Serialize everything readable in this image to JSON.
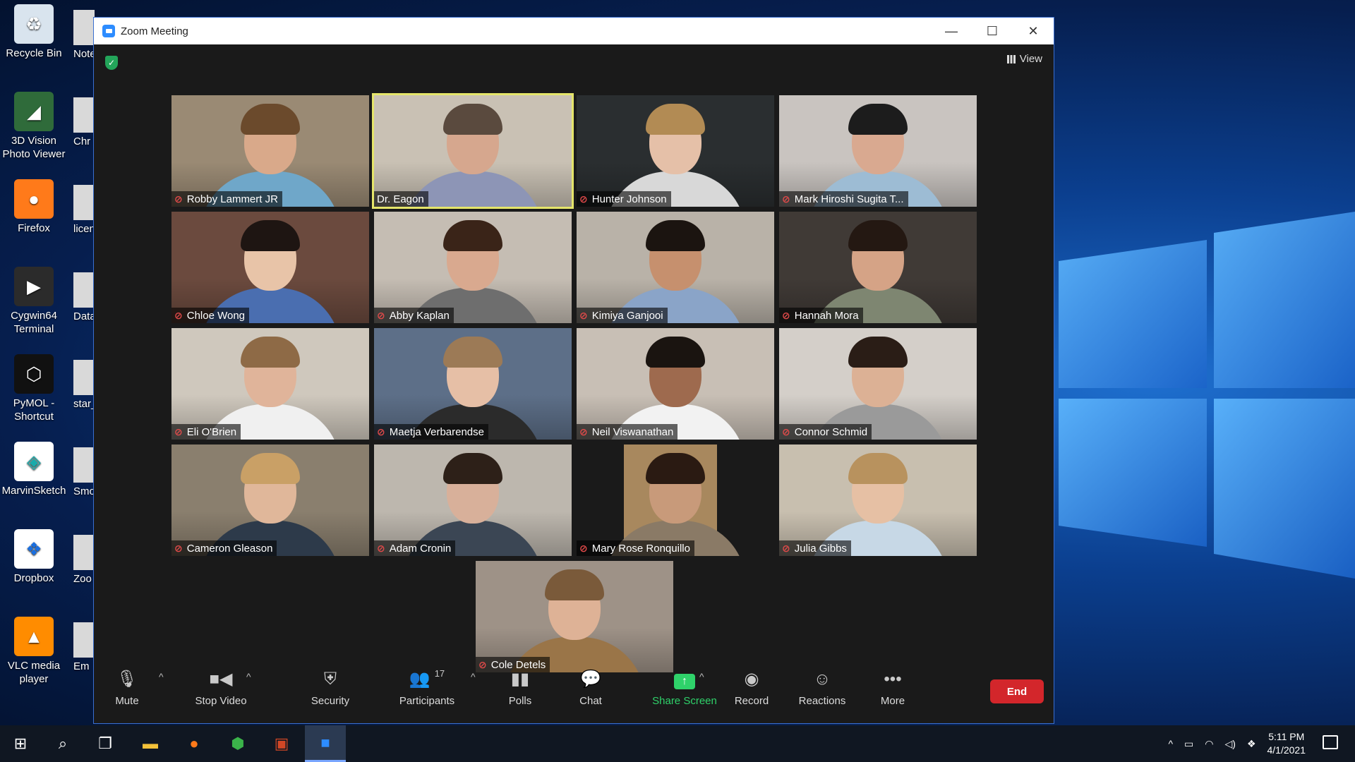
{
  "desktop": {
    "icons": [
      {
        "label_line1": "Recycle Bin",
        "label_line2": "",
        "icon": "recycle-bin-icon"
      },
      {
        "label_line1": "3D Vision",
        "label_line2": "Photo Viewer",
        "icon": "3d-vision-icon"
      },
      {
        "label_line1": "Firefox",
        "label_line2": "",
        "icon": "firefox-icon"
      },
      {
        "label_line1": "Cygwin64",
        "label_line2": "Terminal",
        "icon": "cygwin-icon"
      },
      {
        "label_line1": "PyMOL -",
        "label_line2": "Shortcut",
        "icon": "pymol-icon"
      },
      {
        "label_line1": "MarvinSketch",
        "label_line2": "",
        "icon": "marvinsketch-icon"
      },
      {
        "label_line1": "Dropbox",
        "label_line2": "",
        "icon": "dropbox-icon"
      },
      {
        "label_line1": "VLC media",
        "label_line2": "player",
        "icon": "vlc-icon"
      }
    ],
    "col2_labels": [
      "Note",
      "Chr",
      "licen",
      "Data",
      "star_",
      "Smoo",
      "Zoo",
      "Em"
    ]
  },
  "window": {
    "title": "Zoom Meeting",
    "minimize": "—",
    "maximize": "☐",
    "close": "✕",
    "view_label": "View"
  },
  "participants": [
    {
      "name": "Robby Lammert JR",
      "muted": true,
      "bg": "#9a8a74",
      "skin": "#d9a98a",
      "hair": "#6b4a2c",
      "shirt": "#6fa7c9"
    },
    {
      "name": "Dr. Eagon",
      "muted": false,
      "speaking": true,
      "bg": "#c9c1b4",
      "skin": "#d6a78e",
      "hair": "#5a4a3e",
      "shirt": "#8d95b6"
    },
    {
      "name": "Hunter Johnson",
      "muted": true,
      "bg": "#2a2e30",
      "skin": "#e5c0a8",
      "hair": "#b28b54",
      "shirt": "#d8d8d8"
    },
    {
      "name": "Mark Hiroshi Sugita T...",
      "muted": true,
      "bg": "#c9c4c0",
      "skin": "#d9a990",
      "hair": "#1c1c1c",
      "shirt": "#9dbcd4"
    },
    {
      "name": "Chloe Wong",
      "muted": true,
      "bg": "#6b4a3e",
      "skin": "#e8c4a8",
      "hair": "#1e1512",
      "shirt": "#4a6eb0"
    },
    {
      "name": "Abby Kaplan",
      "muted": true,
      "bg": "#c5bdb3",
      "skin": "#d9a98f",
      "hair": "#3a2418",
      "shirt": "#6e6e6e"
    },
    {
      "name": "Kimiya Ganjooi",
      "muted": true,
      "bg": "#b9b2a8",
      "skin": "#c6906e",
      "hair": "#1b1410",
      "shirt": "#8aa4c8"
    },
    {
      "name": "Hannah Mora",
      "muted": true,
      "bg": "#403a36",
      "skin": "#d5a386",
      "hair": "#241812",
      "shirt": "#7e8671"
    },
    {
      "name": "Eli O'Brien",
      "muted": true,
      "bg": "#cfc8bd",
      "skin": "#e0b49a",
      "hair": "#8e6a46",
      "shirt": "#f0f0f0"
    },
    {
      "name": "Maetja Verbarendse",
      "muted": true,
      "bg": "#5d6f88",
      "skin": "#e6bfa6",
      "hair": "#9c7a56",
      "shirt": "#2b2b2b"
    },
    {
      "name": "Neil Viswanathan",
      "muted": true,
      "bg": "#c8bfb5",
      "skin": "#9e6a4e",
      "hair": "#1a1410",
      "shirt": "#f2f2f2"
    },
    {
      "name": "Connor Schmid",
      "muted": true,
      "bg": "#d4cfc9",
      "skin": "#dcb195",
      "hair": "#2a1d16",
      "shirt": "#9a9a9a"
    },
    {
      "name": "Cameron Gleason",
      "muted": true,
      "bg": "#8a7f6e",
      "skin": "#e0b79a",
      "hair": "#c9a066",
      "shirt": "#2d3a4a"
    },
    {
      "name": "Adam Cronin",
      "muted": true,
      "bg": "#bdb7ae",
      "skin": "#d8b09a",
      "hair": "#2d2018",
      "shirt": "#3b4654"
    },
    {
      "name": "Mary Rose Ronquillo",
      "muted": true,
      "bg": "#a8885e",
      "skin": "#c89a7a",
      "hair": "#2a1a12",
      "shirt": "#8a7a66",
      "narrow": true
    },
    {
      "name": "Julia Gibbs",
      "muted": true,
      "bg": "#c8bfaf",
      "skin": "#e6c0a4",
      "hair": "#b8925e",
      "shirt": "#c7d8e6"
    },
    {
      "name": "Cole Detels",
      "muted": true,
      "bg": "#9e9287",
      "skin": "#deb296",
      "hair": "#7a5a3a",
      "shirt": "#9a7548"
    }
  ],
  "toolbar": {
    "mute": "Mute",
    "stop_video": "Stop Video",
    "security": "Security",
    "participants": "Participants",
    "participant_count": "17",
    "polls": "Polls",
    "chat": "Chat",
    "share_screen": "Share Screen",
    "record": "Record",
    "reactions": "Reactions",
    "more": "More",
    "end": "End"
  },
  "taskbar": {
    "time": "5:11 PM",
    "date": "4/1/2021"
  }
}
